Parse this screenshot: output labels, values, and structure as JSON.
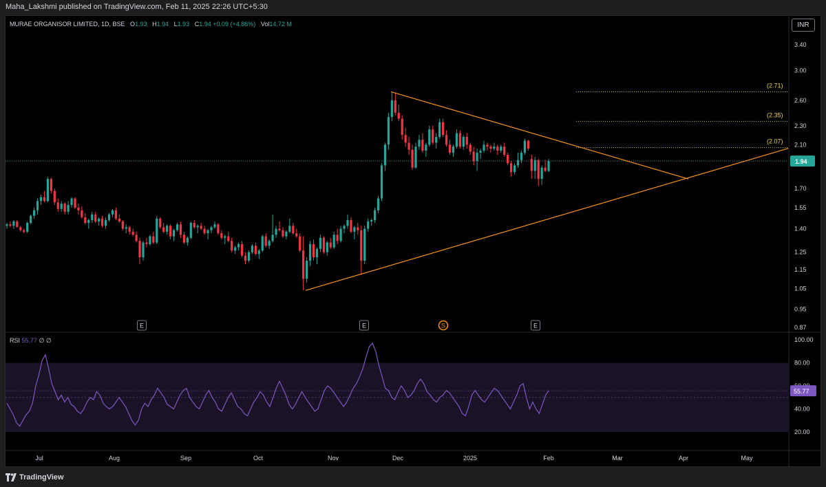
{
  "header": {
    "publisher": "Maha_Lakshmi published on TradingView.com, Feb 11, 2025 22:26 UTC+5:30"
  },
  "legend": {
    "symbol": "MURAE ORGANISOR LIMITED, 1D, BSE",
    "open_label": "O",
    "open": "1.93",
    "high_label": "H",
    "high": "1.94",
    "low_label": "L",
    "low": "1.93",
    "close_label": "C",
    "close": "1.94",
    "change": "+0.09 (+4.86%)",
    "vol_label": "Vol",
    "vol": "14.72 M"
  },
  "currency": "INR",
  "rsi_legend": {
    "name": "RSI",
    "value": "55.77",
    "extra": "∅ ∅"
  },
  "brand": "TradingView",
  "colors": {
    "up": "#26a69a",
    "down": "#f23645",
    "trendline": "#f7931a",
    "rsi": "#7e57c2",
    "fib": "#d4c34a",
    "price_badge": "#26a69a"
  },
  "chart_data": [
    {
      "type": "candlestick",
      "title": "MURAE ORGANISOR LIMITED, 1D, BSE",
      "ylim": [
        0.87,
        3.6
      ],
      "y_scale": "log",
      "y_ticks": [
        "3.40",
        "3.00",
        "2.60",
        "2.30",
        "2.10",
        "1.94",
        "1.70",
        "1.55",
        "1.40",
        "1.25",
        "1.15",
        "1.05",
        "0.95",
        "0.87"
      ],
      "x_ticks": [
        "Jul",
        "Aug",
        "Sep",
        "Oct",
        "Nov",
        "Dec",
        "2025",
        "Feb",
        "Mar",
        "Apr",
        "May"
      ],
      "last_price": "1.94",
      "levels": [
        {
          "label": "(2.71)",
          "value": 2.71
        },
        {
          "label": "(2.35)",
          "value": 2.35
        },
        {
          "label": "(2.07)",
          "value": 2.07
        }
      ],
      "trendlines": [
        {
          "from": [
            "Oct 21",
            1.04
          ],
          "to": [
            "Mar 29",
            1.79
          ]
        },
        {
          "from": [
            "Nov 28",
            2.71
          ],
          "to": [
            "Apr 1",
            1.78
          ]
        }
      ],
      "event_markers": [
        "E",
        "E",
        "S",
        "E"
      ],
      "candles": [
        [
          1.42,
          1.44,
          1.4,
          1.43
        ],
        [
          1.43,
          1.45,
          1.41,
          1.42
        ],
        [
          1.42,
          1.46,
          1.4,
          1.45
        ],
        [
          1.45,
          1.46,
          1.41,
          1.41
        ],
        [
          1.41,
          1.42,
          1.38,
          1.39
        ],
        [
          1.39,
          1.4,
          1.37,
          1.38
        ],
        [
          1.38,
          1.45,
          1.37,
          1.44
        ],
        [
          1.44,
          1.5,
          1.43,
          1.49
        ],
        [
          1.49,
          1.55,
          1.47,
          1.53
        ],
        [
          1.53,
          1.62,
          1.5,
          1.6
        ],
        [
          1.6,
          1.65,
          1.57,
          1.63
        ],
        [
          1.63,
          1.68,
          1.59,
          1.6
        ],
        [
          1.6,
          1.8,
          1.59,
          1.78
        ],
        [
          1.78,
          1.79,
          1.66,
          1.68
        ],
        [
          1.68,
          1.7,
          1.57,
          1.59
        ],
        [
          1.59,
          1.62,
          1.52,
          1.54
        ],
        [
          1.54,
          1.6,
          1.52,
          1.58
        ],
        [
          1.58,
          1.59,
          1.5,
          1.52
        ],
        [
          1.52,
          1.6,
          1.5,
          1.57
        ],
        [
          1.57,
          1.63,
          1.55,
          1.62
        ],
        [
          1.62,
          1.63,
          1.54,
          1.55
        ],
        [
          1.55,
          1.58,
          1.5,
          1.53
        ],
        [
          1.53,
          1.56,
          1.47,
          1.48
        ],
        [
          1.48,
          1.51,
          1.43,
          1.44
        ],
        [
          1.44,
          1.47,
          1.4,
          1.46
        ],
        [
          1.46,
          1.52,
          1.44,
          1.5
        ],
        [
          1.5,
          1.52,
          1.44,
          1.45
        ],
        [
          1.45,
          1.48,
          1.42,
          1.47
        ],
        [
          1.47,
          1.49,
          1.41,
          1.42
        ],
        [
          1.42,
          1.48,
          1.4,
          1.46
        ],
        [
          1.46,
          1.51,
          1.45,
          1.5
        ],
        [
          1.5,
          1.54,
          1.48,
          1.53
        ],
        [
          1.53,
          1.55,
          1.46,
          1.47
        ],
        [
          1.47,
          1.5,
          1.44,
          1.45
        ],
        [
          1.45,
          1.46,
          1.39,
          1.4
        ],
        [
          1.4,
          1.43,
          1.37,
          1.41
        ],
        [
          1.41,
          1.42,
          1.36,
          1.38
        ],
        [
          1.38,
          1.4,
          1.35,
          1.36
        ],
        [
          1.36,
          1.38,
          1.31,
          1.32
        ],
        [
          1.32,
          1.34,
          1.18,
          1.22
        ],
        [
          1.22,
          1.32,
          1.2,
          1.31
        ],
        [
          1.31,
          1.34,
          1.28,
          1.3
        ],
        [
          1.3,
          1.36,
          1.29,
          1.35
        ],
        [
          1.35,
          1.38,
          1.3,
          1.31
        ],
        [
          1.31,
          1.49,
          1.3,
          1.47
        ],
        [
          1.47,
          1.48,
          1.4,
          1.41
        ],
        [
          1.41,
          1.44,
          1.37,
          1.38
        ],
        [
          1.38,
          1.43,
          1.36,
          1.42
        ],
        [
          1.42,
          1.43,
          1.33,
          1.35
        ],
        [
          1.35,
          1.4,
          1.32,
          1.39
        ],
        [
          1.39,
          1.44,
          1.38,
          1.43
        ],
        [
          1.43,
          1.45,
          1.34,
          1.36
        ],
        [
          1.36,
          1.38,
          1.3,
          1.31
        ],
        [
          1.31,
          1.35,
          1.29,
          1.34
        ],
        [
          1.34,
          1.45,
          1.33,
          1.44
        ],
        [
          1.44,
          1.46,
          1.4,
          1.41
        ],
        [
          1.41,
          1.43,
          1.37,
          1.42
        ],
        [
          1.42,
          1.44,
          1.39,
          1.4
        ],
        [
          1.4,
          1.42,
          1.36,
          1.37
        ],
        [
          1.37,
          1.4,
          1.33,
          1.39
        ],
        [
          1.39,
          1.42,
          1.37,
          1.41
        ],
        [
          1.41,
          1.45,
          1.4,
          1.43
        ],
        [
          1.43,
          1.44,
          1.36,
          1.37
        ],
        [
          1.37,
          1.39,
          1.33,
          1.34
        ],
        [
          1.34,
          1.36,
          1.3,
          1.35
        ],
        [
          1.35,
          1.38,
          1.31,
          1.32
        ],
        [
          1.32,
          1.34,
          1.25,
          1.26
        ],
        [
          1.26,
          1.29,
          1.24,
          1.28
        ],
        [
          1.28,
          1.31,
          1.26,
          1.3
        ],
        [
          1.3,
          1.32,
          1.22,
          1.23
        ],
        [
          1.23,
          1.25,
          1.18,
          1.2
        ],
        [
          1.2,
          1.26,
          1.19,
          1.25
        ],
        [
          1.25,
          1.3,
          1.24,
          1.29
        ],
        [
          1.29,
          1.31,
          1.23,
          1.24
        ],
        [
          1.24,
          1.27,
          1.21,
          1.26
        ],
        [
          1.26,
          1.36,
          1.25,
          1.35
        ],
        [
          1.35,
          1.37,
          1.28,
          1.29
        ],
        [
          1.29,
          1.33,
          1.27,
          1.32
        ],
        [
          1.32,
          1.5,
          1.31,
          1.36
        ],
        [
          1.36,
          1.42,
          1.34,
          1.4
        ],
        [
          1.4,
          1.45,
          1.38,
          1.39
        ],
        [
          1.39,
          1.41,
          1.34,
          1.35
        ],
        [
          1.35,
          1.39,
          1.33,
          1.38
        ],
        [
          1.38,
          1.47,
          1.37,
          1.42
        ],
        [
          1.42,
          1.44,
          1.36,
          1.37
        ],
        [
          1.37,
          1.4,
          1.34,
          1.35
        ],
        [
          1.35,
          1.37,
          1.25,
          1.26
        ],
        [
          1.26,
          1.35,
          1.04,
          1.1
        ],
        [
          1.1,
          1.22,
          1.08,
          1.2
        ],
        [
          1.2,
          1.32,
          1.17,
          1.3
        ],
        [
          1.3,
          1.33,
          1.2,
          1.22
        ],
        [
          1.22,
          1.28,
          1.18,
          1.27
        ],
        [
          1.27,
          1.36,
          1.25,
          1.34
        ],
        [
          1.34,
          1.35,
          1.24,
          1.25
        ],
        [
          1.25,
          1.32,
          1.23,
          1.31
        ],
        [
          1.31,
          1.34,
          1.27,
          1.28
        ],
        [
          1.28,
          1.38,
          1.27,
          1.36
        ],
        [
          1.36,
          1.4,
          1.3,
          1.32
        ],
        [
          1.32,
          1.42,
          1.31,
          1.4
        ],
        [
          1.4,
          1.43,
          1.37,
          1.42
        ],
        [
          1.42,
          1.5,
          1.4,
          1.46
        ],
        [
          1.46,
          1.48,
          1.37,
          1.38
        ],
        [
          1.38,
          1.42,
          1.33,
          1.41
        ],
        [
          1.41,
          1.44,
          1.36,
          1.39
        ],
        [
          1.39,
          1.42,
          1.12,
          1.2
        ],
        [
          1.2,
          1.42,
          1.18,
          1.4
        ],
        [
          1.4,
          1.47,
          1.38,
          1.45
        ],
        [
          1.45,
          1.47,
          1.42,
          1.46
        ],
        [
          1.46,
          1.55,
          1.44,
          1.53
        ],
        [
          1.53,
          1.64,
          1.51,
          1.62
        ],
        [
          1.62,
          1.92,
          1.6,
          1.9
        ],
        [
          1.9,
          2.12,
          1.85,
          2.1
        ],
        [
          2.1,
          2.45,
          2.05,
          2.4
        ],
        [
          2.4,
          2.71,
          2.35,
          2.6
        ],
        [
          2.6,
          2.7,
          2.42,
          2.45
        ],
        [
          2.45,
          2.55,
          2.35,
          2.38
        ],
        [
          2.38,
          2.42,
          2.15,
          2.2
        ],
        [
          2.2,
          2.28,
          2.08,
          2.12
        ],
        [
          2.12,
          2.18,
          2.0,
          2.05
        ],
        [
          2.05,
          2.1,
          1.86,
          1.88
        ],
        [
          1.88,
          2.12,
          1.87,
          2.08
        ],
        [
          2.08,
          2.2,
          2.05,
          2.15
        ],
        [
          2.15,
          2.22,
          2.02,
          2.04
        ],
        [
          2.04,
          2.12,
          1.98,
          2.1
        ],
        [
          2.1,
          2.3,
          2.08,
          2.26
        ],
        [
          2.26,
          2.3,
          2.1,
          2.12
        ],
        [
          2.12,
          2.22,
          2.06,
          2.18
        ],
        [
          2.18,
          2.38,
          2.16,
          2.34
        ],
        [
          2.34,
          2.38,
          2.18,
          2.2
        ],
        [
          2.2,
          2.25,
          2.08,
          2.1
        ],
        [
          2.1,
          2.15,
          2.0,
          2.02
        ],
        [
          2.02,
          2.1,
          1.98,
          2.08
        ],
        [
          2.08,
          2.26,
          2.06,
          2.22
        ],
        [
          2.22,
          2.25,
          2.06,
          2.08
        ],
        [
          2.08,
          2.2,
          2.05,
          2.18
        ],
        [
          2.18,
          2.22,
          2.06,
          2.1
        ],
        [
          2.1,
          2.12,
          2.0,
          2.03
        ],
        [
          2.03,
          2.08,
          1.9,
          1.94
        ],
        [
          1.94,
          2.06,
          1.85,
          2.02
        ],
        [
          2.02,
          2.06,
          1.96,
          2.04
        ],
        [
          2.04,
          2.14,
          2.02,
          2.1
        ],
        [
          2.1,
          2.12,
          2.04,
          2.08
        ],
        [
          2.08,
          2.1,
          2.02,
          2.06
        ],
        [
          2.06,
          2.12,
          2.04,
          2.08
        ],
        [
          2.08,
          2.1,
          2.0,
          2.04
        ],
        [
          2.04,
          2.1,
          2.02,
          2.08
        ],
        [
          2.08,
          2.12,
          1.98,
          2.0
        ],
        [
          2.0,
          2.02,
          1.9,
          1.92
        ],
        [
          1.92,
          1.94,
          1.8,
          1.84
        ],
        [
          1.84,
          1.92,
          1.82,
          1.9
        ],
        [
          1.9,
          2.02,
          1.88,
          1.95
        ],
        [
          1.95,
          2.04,
          1.92,
          2.02
        ],
        [
          2.02,
          2.16,
          2.0,
          2.14
        ],
        [
          2.14,
          2.15,
          2.04,
          2.06
        ],
        [
          1.96,
          2.0,
          1.78,
          1.85
        ],
        [
          1.85,
          1.98,
          1.78,
          1.95
        ],
        [
          1.95,
          1.96,
          1.72,
          1.78
        ],
        [
          1.78,
          1.9,
          1.73,
          1.88
        ],
        [
          1.88,
          1.95,
          1.84,
          1.85
        ],
        [
          1.85,
          1.96,
          1.84,
          1.94
        ]
      ]
    },
    {
      "type": "line",
      "name": "RSI",
      "ylim": [
        10,
        100
      ],
      "y_ticks": [
        "100.00",
        "80.00",
        "60.00",
        "40.00",
        "20.00"
      ],
      "band": [
        30,
        70
      ],
      "last_value": "55.77",
      "values": [
        45,
        40,
        35,
        28,
        25,
        30,
        35,
        38,
        45,
        60,
        70,
        82,
        87,
        75,
        62,
        55,
        48,
        52,
        46,
        50,
        44,
        42,
        38,
        36,
        40,
        46,
        50,
        48,
        55,
        52,
        45,
        42,
        40,
        42,
        46,
        50,
        46,
        42,
        36,
        30,
        26,
        30,
        40,
        45,
        42,
        48,
        52,
        58,
        54,
        50,
        44,
        42,
        40,
        46,
        52,
        56,
        58,
        50,
        46,
        42,
        40,
        46,
        52,
        56,
        50,
        46,
        40,
        38,
        44,
        50,
        54,
        48,
        42,
        40,
        36,
        34,
        40,
        46,
        50,
        55,
        52,
        46,
        42,
        50,
        58,
        64,
        58,
        52,
        44,
        40,
        44,
        50,
        55,
        50,
        46,
        42,
        38,
        40,
        48,
        56,
        60,
        58,
        54,
        50,
        46,
        42,
        46,
        52,
        58,
        62,
        68,
        75,
        85,
        94,
        97,
        90,
        78,
        68,
        58,
        56,
        50,
        48,
        55,
        60,
        56,
        50,
        52,
        56,
        62,
        66,
        62,
        55,
        52,
        48,
        46,
        50,
        52,
        56,
        54,
        50,
        46,
        42,
        36,
        34,
        42,
        52,
        56,
        52,
        48,
        46,
        50,
        54,
        58,
        56,
        52,
        48,
        44,
        40,
        46,
        52,
        60,
        62,
        50,
        40,
        46,
        40,
        36,
        44,
        52,
        56
      ]
    }
  ]
}
